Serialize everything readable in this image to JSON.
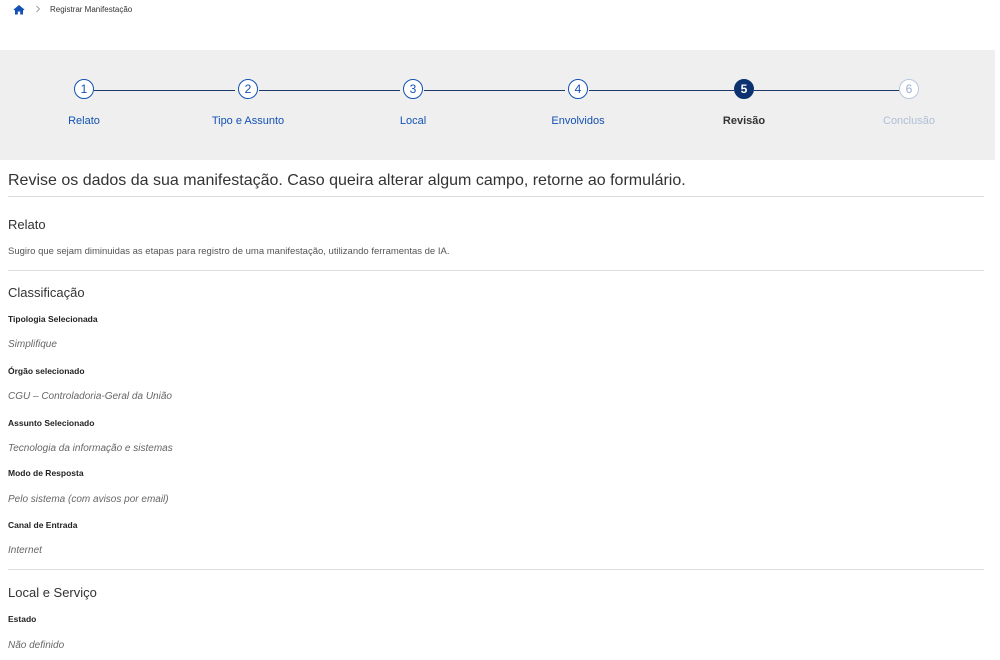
{
  "breadcrumb": {
    "home_icon": "home-icon",
    "separator_icon": "chevron-right-icon",
    "current": "Registrar Manifestação"
  },
  "steps": [
    {
      "number": "1",
      "label": "Relato",
      "state": "done"
    },
    {
      "number": "2",
      "label": "Tipo e Assunto",
      "state": "done"
    },
    {
      "number": "3",
      "label": "Local",
      "state": "done"
    },
    {
      "number": "4",
      "label": "Envolvidos",
      "state": "done"
    },
    {
      "number": "5",
      "label": "Revisão",
      "state": "active"
    },
    {
      "number": "6",
      "label": "Conclusão",
      "state": "disabled"
    }
  ],
  "page_title": "Revise os dados da sua manifestação. Caso queira alterar algum campo, retorne ao formulário.",
  "relato": {
    "title": "Relato",
    "text": "Sugiro que sejam diminuidas as etapas para registro de uma manifestação, utilizando ferramentas de IA."
  },
  "classificacao": {
    "title": "Classificação",
    "fields": [
      {
        "label": "Tipologia Selecionada",
        "value": "Simplifique"
      },
      {
        "label": "Órgão selecionado",
        "value": "CGU – Controladoria-Geral da União"
      },
      {
        "label": "Assunto Selecionado",
        "value": "Tecnologia da informação e sistemas"
      },
      {
        "label": "Modo de Resposta",
        "value": "Pelo sistema (com avisos por email)"
      },
      {
        "label": "Canal de Entrada",
        "value": "Internet"
      }
    ]
  },
  "local_servico": {
    "title": "Local e Serviço",
    "fields": [
      {
        "label": "Estado",
        "value": "Não definido"
      }
    ]
  },
  "colors": {
    "primary": "#1351b4",
    "active": "#0c326f",
    "stepper_bg": "#efefef",
    "disabled": "#b9c8e0"
  }
}
